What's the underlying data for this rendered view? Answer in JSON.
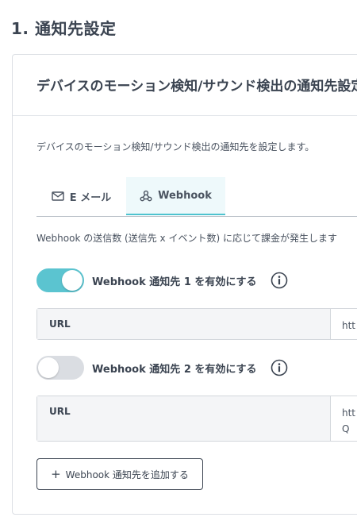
{
  "section": {
    "title": "1. 通知先設定"
  },
  "card": {
    "title": "デバイスのモーション検知/サウンド検出の通知先設定",
    "description": "デバイスのモーション検知/サウンド検出の通知先を設定します。"
  },
  "tabs": [
    {
      "label": "E メール",
      "icon": "mail-icon",
      "active": false
    },
    {
      "label": "Webhook",
      "icon": "webhook-icon",
      "active": true
    }
  ],
  "webhook": {
    "note": "Webhook の送信数 (送信先 x イベント数) に応じて課金が発生します",
    "destinations": [
      {
        "toggle_label": "Webhook 通知先 1 を有効にする",
        "enabled": true,
        "url_label": "URL",
        "url_value": "htt"
      },
      {
        "toggle_label": "Webhook 通知先 2 を有効にする",
        "enabled": false,
        "url_label": "URL",
        "url_value": "htt eQ"
      }
    ],
    "add_label": "Webhook 通知先を追加する"
  },
  "colors": {
    "accent": "#5bc4d0",
    "tab_active_bg": "#eef9fb",
    "text": "#3b4451",
    "toggle_off": "#dadde2"
  }
}
